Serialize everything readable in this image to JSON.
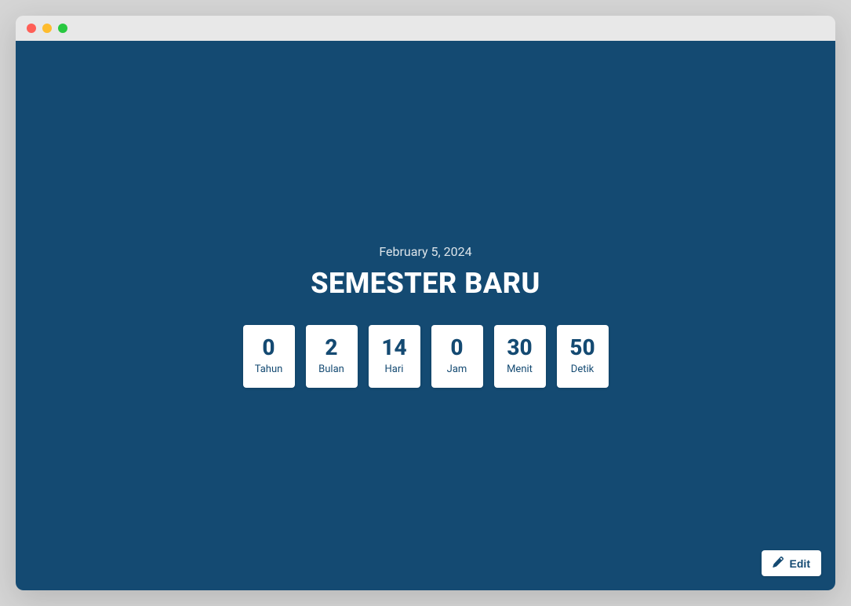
{
  "header": {
    "date": "February 5, 2024",
    "title": "SEMESTER BARU"
  },
  "countdown": [
    {
      "value": "0",
      "label": "Tahun"
    },
    {
      "value": "2",
      "label": "Bulan"
    },
    {
      "value": "14",
      "label": "Hari"
    },
    {
      "value": "0",
      "label": "Jam"
    },
    {
      "value": "30",
      "label": "Menit"
    },
    {
      "value": "50",
      "label": "Detik"
    }
  ],
  "actions": {
    "edit_label": "Edit"
  }
}
